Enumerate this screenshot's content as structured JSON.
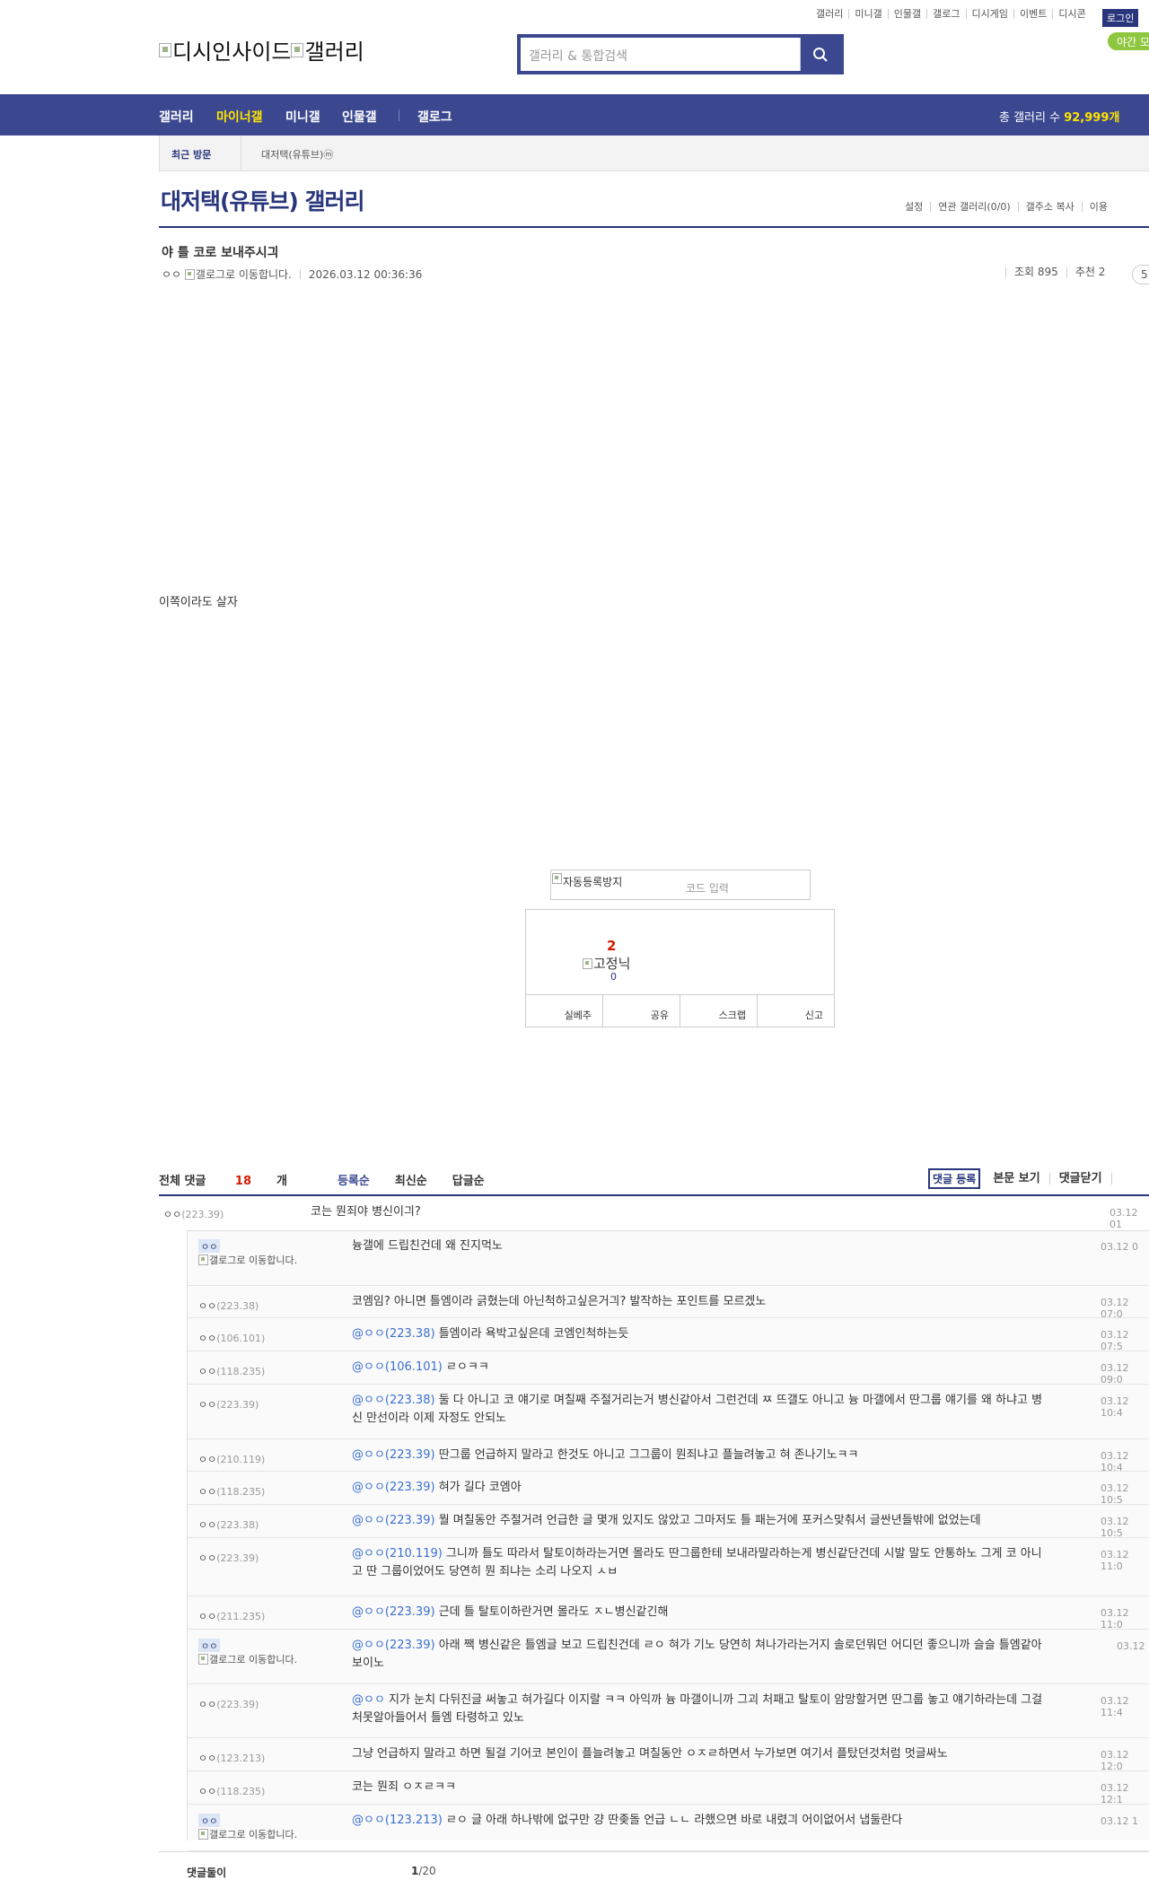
{
  "top_menu": [
    "갤러리",
    "미니갤",
    "인물갤",
    "갤로그",
    "디시게임",
    "이벤트",
    "디시콘"
  ],
  "login_label": "로그인",
  "darkmode_label": "야간 모",
  "logo": {
    "part1": "디시인사이드",
    "part2": "갤러리"
  },
  "search": {
    "placeholder": "갤러리 & 통합검색"
  },
  "nav": {
    "items": [
      "갤러리",
      "마이너갤",
      "미니갤",
      "인물갤",
      "갤로그"
    ],
    "total_label": "총 갤러리 수",
    "total_count": "92,999개"
  },
  "recent": {
    "label": "최근 방문",
    "item": "대저택(유튜브)",
    "badge": "ⓜ"
  },
  "gallery": {
    "title": "대저택(유튜브) 갤러리",
    "tools": [
      "설정",
      "연관 갤러리(0/0)",
      "갤주소 복사",
      "이용"
    ]
  },
  "post": {
    "title": "야 틀 코로 보내주시긔",
    "writer": "ㅇㅇ",
    "gallog_alt": "갤로그로 이동합니다.",
    "date": "2026.03.12 00:36:36",
    "views": "조회 895",
    "recommend": "추천 2",
    "comment_badge": "5",
    "body": "이쪽이라도 살자"
  },
  "captcha": {
    "alt": "자동등록방지",
    "placeholder": "코드 입력"
  },
  "recommend_box": {
    "up_count": "2",
    "fixed_alt": "고정닉",
    "fixed_count": "0",
    "buttons": [
      "실베추",
      "공유",
      "스크랩",
      "신고"
    ]
  },
  "comments_header": {
    "total_label": "전체 댓글",
    "total_count": "18",
    "unit": "개",
    "sorts": [
      "등록순",
      "최신순",
      "답글순"
    ],
    "register": "댓글 등록",
    "view_body": "본문 보기",
    "close": "댓글닫기"
  },
  "main_comment": {
    "nick": "ㅇㅇ",
    "ip": "(223.39)",
    "text": "코는 뭔죄야 병신이긔?",
    "date": "03.12 01"
  },
  "replies": [
    {
      "gallog": true,
      "nick": "ㅇㅇ",
      "ip": "",
      "at": "",
      "text": "늉갤에 드립친건데 왜 진지먹노",
      "date": "03.12 0"
    },
    {
      "gallog": false,
      "nick": "ㅇㅇ",
      "ip": "(223.38)",
      "at": "",
      "text": "코엠임? 아니면 틀엠이라 긁혔는데 아닌척하고싶은거긔? 발작하는 포인트를 모르겠노",
      "date": "03.12 07:0"
    },
    {
      "gallog": false,
      "nick": "ㅇㅇ",
      "ip": "(106.101)",
      "at": "@ㅇㅇ(223.38)",
      "text": " 틀엠이라 욕박고싶은데 코엠인척하는듯",
      "date": "03.12 07:5"
    },
    {
      "gallog": false,
      "nick": "ㅇㅇ",
      "ip": "(118.235)",
      "at": "@ㅇㅇ(106.101)",
      "text": " ㄹㅇㅋㅋ",
      "date": "03.12 09:0"
    },
    {
      "gallog": false,
      "nick": "ㅇㅇ",
      "ip": "(223.39)",
      "at": "@ㅇㅇ(223.38)",
      "text": " 둘 다 아니고 코 얘기로 며칠째 주절거리는거 병신같아서 그런건데 ㅉ 뜨갤도 아니고 늉 마갤에서 딴그룹 얘기를 왜 하냐고 병신 만선이라 이제 자정도 안되노",
      "date": "03.12 10:4"
    },
    {
      "gallog": false,
      "nick": "ㅇㅇ",
      "ip": "(210.119)",
      "at": "@ㅇㅇ(223.39)",
      "text": " 딴그룹 언급하지 말라고 한것도 아니고 그그룹이 뭔죄냐고 플늘려놓고 혀 존나기노ㅋㅋ",
      "date": "03.12 10:4"
    },
    {
      "gallog": false,
      "nick": "ㅇㅇ",
      "ip": "(118.235)",
      "at": "@ㅇㅇ(223.39)",
      "text": " 혀가 길다 코엠아",
      "date": "03.12 10:5"
    },
    {
      "gallog": false,
      "nick": "ㅇㅇ",
      "ip": "(223.38)",
      "at": "@ㅇㅇ(223.39)",
      "text": " 뭘 며칠동안 주절거려 언급한 글 몇개 있지도 않았고 그마저도 틀 패는거에 포커스맞춰서 글싼년들밖에 없었는데",
      "date": "03.12 10:5"
    },
    {
      "gallog": false,
      "nick": "ㅇㅇ",
      "ip": "(223.39)",
      "at": "@ㅇㅇ(210.119)",
      "text": " 그니까 틀도 따라서 탈토이하라는거면 몰라도 딴그룹한테 보내라말라하는게 병신같단건데 시발 말도 안통하노 그게 코 아니고 딴 그룹이었어도 당연히 뭔 죄냐는 소리 나오지 ㅅㅂ",
      "date": "03.12 11:0"
    },
    {
      "gallog": false,
      "nick": "ㅇㅇ",
      "ip": "(211.235)",
      "at": "@ㅇㅇ(223.39)",
      "text": " 근데 틀 탈토이하란거면 몰라도 ㅈㄴ병신같긴해",
      "date": "03.12 11:0"
    },
    {
      "gallog": true,
      "nick": "ㅇㅇ",
      "ip": "",
      "at": "@ㅇㅇ(223.39)",
      "text": " 아래 짹 병신같은 틀엠글 보고 드립친건데 ㄹㅇ 혀가 기노 당연히 쳐나가라는거지 솔로던뭐던 어디던 좋으니까 슬슬 틀엠같아보이노",
      "date": "03.12"
    },
    {
      "gallog": false,
      "nick": "ㅇㅇ",
      "ip": "(223.39)",
      "at": "@ㅇㅇ",
      "text": " 지가 눈치 다뒤진글 써놓고 혀가길다 이지랄 ㅋㅋ 아익까 늉 마갤이니까 그괴 처패고 탈토이 암망할거면 딴그룹 놓고 얘기하라는데 그걸 처못알아들어서 틀엠 타령하고 있노",
      "date": "03.12 11:4"
    },
    {
      "gallog": false,
      "nick": "ㅇㅇ",
      "ip": "(123.213)",
      "at": "",
      "text": "그냥 언급하지 말라고 하면 될걸 기어코 본인이 플늘려놓고 며칠동안 ㅇㅈㄹ하면서 누가보면 여기서 플탔던것처럼 멋글싸노",
      "date": "03.12 12:0"
    },
    {
      "gallog": false,
      "nick": "ㅇㅇ",
      "ip": "(118.235)",
      "at": "",
      "text": "코는 뭔죄 ㅇㅈㄹㅋㅋ",
      "date": "03.12 12:1"
    },
    {
      "gallog": true,
      "nick": "ㅇㅇ",
      "ip": "",
      "at": "@ㅇㅇ(123.213)",
      "text": " ㄹㅇ 글 아래 하나밖에 없구만 걍 딴좆돌 언급 ㄴㄴ 라했으면 바로 내렸긔 어이없어서 냅둘란다",
      "date": "03.12 1"
    }
  ],
  "pager": {
    "label": "댓글둘이",
    "current": "1",
    "total": "/20"
  }
}
